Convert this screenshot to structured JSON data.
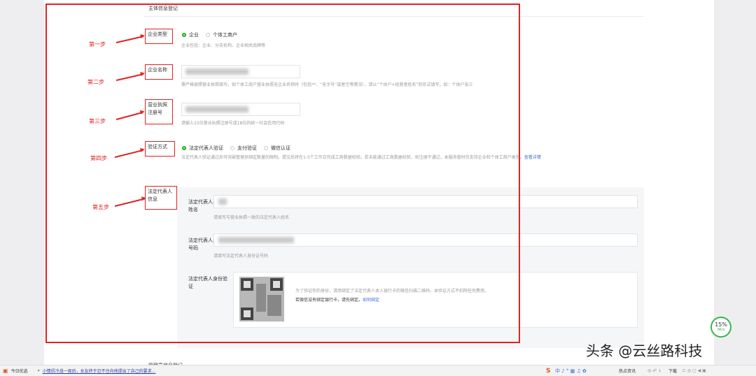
{
  "section": {
    "title": "主体信息登记",
    "footer_title": "管理员信息登记"
  },
  "steps": [
    "第一步",
    "第二步",
    "第三步",
    "第四步",
    "第五步"
  ],
  "fields": {
    "company_type": {
      "label": "企业类型",
      "options": [
        "企业",
        "个体工商户"
      ],
      "selected": "企业",
      "hint": "企业包括：企业、分支机构、企业相关品牌等"
    },
    "company_name": {
      "label": "企业名称",
      "hint": "需严格按照营业执照填写。如个体工商户营业执照无企业名称时（包括**、“无字号”或者空等情况），请以“个体户+经营者姓名”的形式填写，如：个体户张三"
    },
    "license_number": {
      "label": "营业执照注册号",
      "hint": "请输入15位营业执照注册号或18位的统一社会信用代码"
    },
    "verify_method": {
      "label": "验证方式",
      "options": [
        "法定代表人验证",
        "支付验证",
        "微信认证"
      ],
      "selected": "法定代表人验证",
      "hint": "法定代表人验证通过后可突破管理员绑定数量的限制。提交后将在1-5个工作日完成工商数据校验。若未能通过工商数据校验，则注册不通过。本服务暂时仅支持企业和个体工商户类型。",
      "hint_link": "查看详情"
    },
    "legal_rep": {
      "label": "法定代表人信息",
      "name_label": "法定代表人身份证姓名",
      "name_hint": "请填写与营业执照一致的法定代表人姓名",
      "id_label": "法定代表人身份证号码",
      "id_hint": "请填写法定代表人身份证号码",
      "verify_label": "法定代表人身份验证",
      "qr_hint": "为了验证你的身份，请用绑定了法定代表人本人银行卡的微信扫描二维码。本验证方式不扣除任何费用。",
      "qr_hint2": "若微信没有绑定银行卡，请先绑定。",
      "qr_link": "如何绑定"
    }
  },
  "taskbar": {
    "app": "今日优选",
    "news": "小情侣冷战一周后，女友终于忍不住向他提出了自己的要求...",
    "tray": "热点资讯",
    "download": "下载"
  },
  "net_speed": {
    "percent": "15%",
    "rate": "0K/s"
  },
  "watermark": "头条 @云丝路科技",
  "colors": {
    "annotation": "#e02323",
    "radio_selected": "#1aad19",
    "link": "#3a6fd6"
  }
}
